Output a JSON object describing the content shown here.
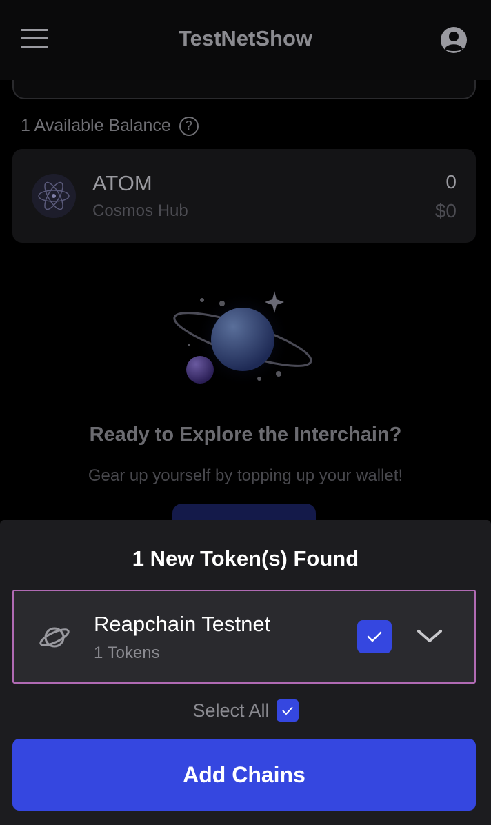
{
  "header": {
    "title": "TestNetShow",
    "menu_icon": "hamburger-menu-icon",
    "profile_icon": "user-avatar-icon"
  },
  "balance": {
    "label": "1 Available Balance",
    "help_glyph": "?"
  },
  "tokens": [
    {
      "symbol": "ATOM",
      "chain": "Cosmos Hub",
      "amount": "0",
      "usd": "$0"
    }
  ],
  "empty_state": {
    "title": "Ready to Explore the Interchain?",
    "subtitle": "Gear up yourself by topping up your wallet!"
  },
  "sheet": {
    "title": "1 New Token(s) Found",
    "chains": [
      {
        "name": "Reapchain Testnet",
        "tokens": "1 Tokens",
        "checked": true
      }
    ],
    "select_all_label": "Select All",
    "add_button": "Add Chains"
  },
  "colors": {
    "accent": "#3547e0",
    "highlight_border": "#b06ab3",
    "sheet_bg": "#1c1c1f"
  }
}
